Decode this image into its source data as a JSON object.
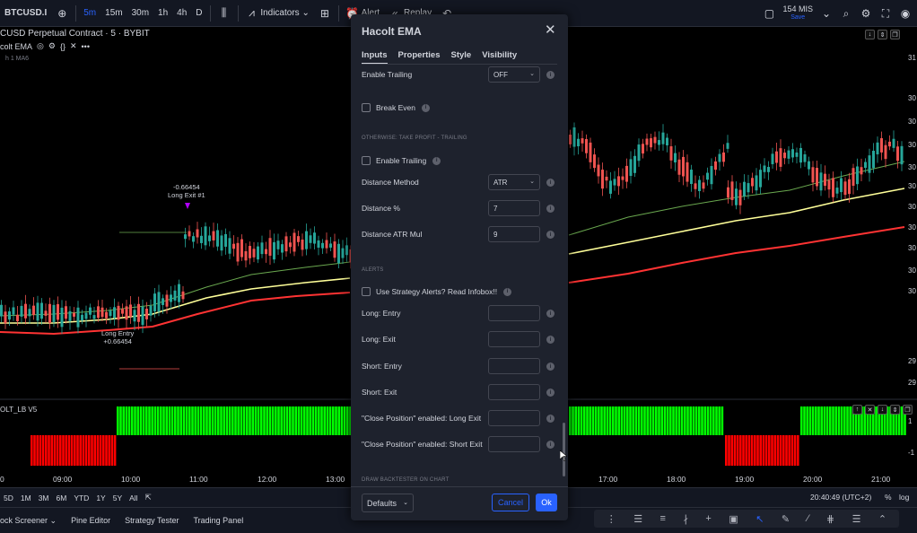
{
  "toolbar": {
    "ticker": "BTCUSD.I",
    "intervals": [
      "5m",
      "15m",
      "30m",
      "1h",
      "4h",
      "D"
    ],
    "active_interval": "5m",
    "indicators_label": "Indicators",
    "alert_label": "Alert",
    "replay_label": "Replay",
    "ms_value": "154 MIS",
    "save_label": "Save"
  },
  "chart": {
    "symbol_title": "CUSD Perpetual Contract · 5 · BYBIT",
    "indicator_legend": "colt EMA",
    "sub_legend": "h 1 MA6",
    "oscillator_legend": "OLT_LB V5",
    "annotation_exit": {
      "value": "-0.66454",
      "label": "Long Exit #1"
    },
    "annotation_entry": {
      "label": "Long Entry",
      "value": "+0.66454"
    },
    "time_labels": [
      "0",
      "09:00",
      "10:00",
      "11:00",
      "12:00",
      "13:00",
      "17:00",
      "18:00",
      "19:00",
      "20:00",
      "21:00"
    ],
    "price_labels": [
      "31",
      "30",
      "30",
      "30",
      "30",
      "30",
      "30",
      "30",
      "30",
      "30",
      "30",
      "29",
      "29",
      "1",
      "-1"
    ]
  },
  "dialog": {
    "title": "Hacolt EMA",
    "tabs": [
      "Inputs",
      "Properties",
      "Style",
      "Visibility"
    ],
    "active_tab": "Inputs",
    "rows": {
      "enable_trailing_top": {
        "label": "Enable Trailing",
        "value": "OFF"
      },
      "break_even": {
        "label": "Break Even"
      },
      "section_tp": "OTHERWISE: TAKE PROFIT - TRAILING",
      "enable_trailing": {
        "label": "Enable Trailing"
      },
      "distance_method": {
        "label": "Distance Method",
        "value": "ATR"
      },
      "distance_pct": {
        "label": "Distance %",
        "value": "7"
      },
      "distance_atr": {
        "label": "Distance ATR Mul",
        "value": "9"
      },
      "section_alerts": "ALERTS",
      "use_alerts": {
        "label": "Use Strategy Alerts? Read Infobox!!"
      },
      "long_entry": {
        "label": "Long: Entry",
        "value": ""
      },
      "long_exit": {
        "label": "Long: Exit",
        "value": ""
      },
      "short_entry": {
        "label": "Short: Entry",
        "value": ""
      },
      "short_exit": {
        "label": "Short: Exit",
        "value": ""
      },
      "close_long": {
        "label": "\"Close Position\" enabled: Long Exit",
        "value": ""
      },
      "close_short": {
        "label": "\"Close Position\" enabled: Short Exit",
        "value": ""
      },
      "section_backtester": "DRAW BACKTESTER ON CHART"
    },
    "footer": {
      "defaults": "Defaults",
      "cancel": "Cancel",
      "ok": "Ok"
    }
  },
  "rangebar": {
    "ranges": [
      "5D",
      "1M",
      "3M",
      "6M",
      "YTD",
      "1Y",
      "5Y",
      "All"
    ],
    "clock": "20:40:49 (UTC+2)",
    "pct": "%",
    "log": "log"
  },
  "panels": [
    "ock Screener",
    "Pine Editor",
    "Strategy Tester",
    "Trading Panel"
  ],
  "colors": {
    "accent": "#2962ff",
    "up": "#26a69a",
    "down": "#ef5350",
    "osc_green": "#00ff00",
    "osc_red": "#ff0000",
    "ema_yellow": "#ffff99",
    "ema_red": "#ff3333",
    "ema_green": "#6aa84f"
  }
}
